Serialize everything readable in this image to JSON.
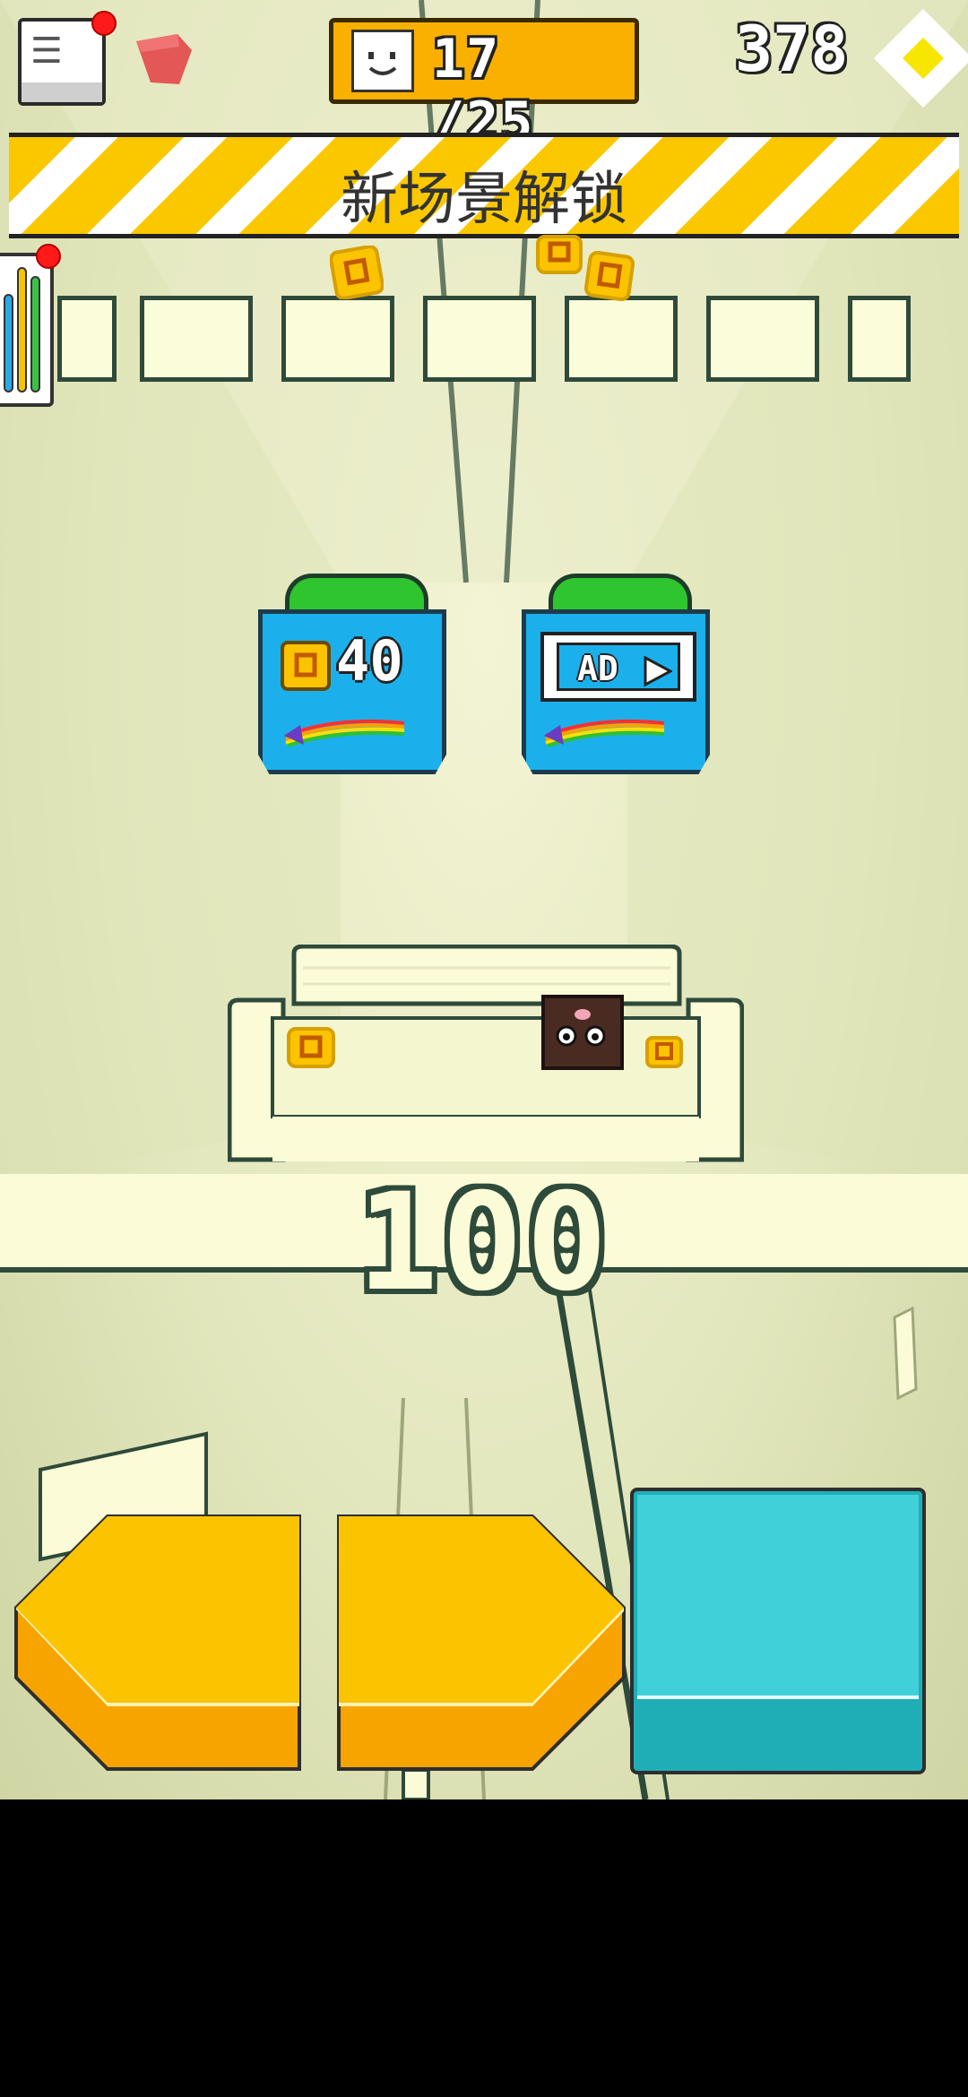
{
  "hud": {
    "progress_text": "17 /25",
    "gem_count": "378"
  },
  "banner": {
    "text": "新场景解锁"
  },
  "upgrades": [
    {
      "type": "coin",
      "price": "40"
    },
    {
      "type": "ad",
      "label": "AD"
    }
  ],
  "score": "100",
  "colors": {
    "banner_stripe": "#fbc800",
    "card_blue": "#1bb0ec",
    "card_cap_green": "#2fc52f",
    "arrow_button": "#fbb800",
    "jump_button": "#2cc7d0",
    "notification": "#ff1a1a"
  },
  "icons": {
    "menu": "menu-icon",
    "hat": "red-hat-icon",
    "face": "smiley-face-icon",
    "gem": "yellow-gem-icon",
    "stats": "stats-bars-icon",
    "coin": "coin-icon",
    "rainbow": "rainbow-trail-icon",
    "play": "play-icon"
  }
}
